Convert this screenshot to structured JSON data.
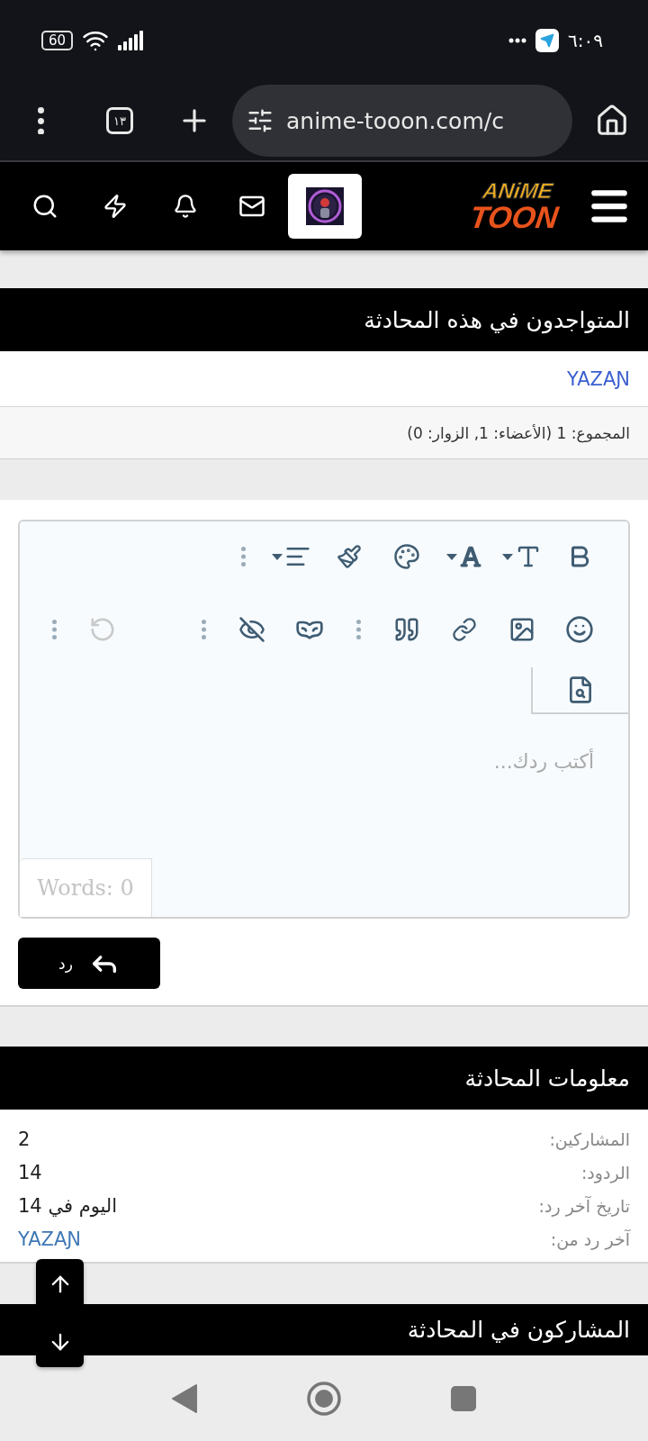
{
  "status_bar": {
    "time": "٦:٠٩",
    "battery": "60"
  },
  "browser": {
    "tab_count": "١٣",
    "url": "anime-tooon.com/c"
  },
  "site_header": {
    "logo": {
      "top": "ANiME",
      "bottom": "TOON"
    }
  },
  "online_section": {
    "title": "المتواجدون في هذه المحادثة",
    "members": [
      {
        "name": "YAZAƝ"
      }
    ],
    "total": "المجموع: 1 (الأعضاء: 1, الزوار: 0)"
  },
  "editor": {
    "placeholder": "أكتب ردك...",
    "word_count": "Words: 0",
    "undo_disabled": true,
    "reply_button": "رد"
  },
  "info_section": {
    "title": "معلومات المحادثة",
    "rows": [
      {
        "label": "المشاركين:",
        "value": "2",
        "kind": "text"
      },
      {
        "label": "الردود:",
        "value": "14",
        "kind": "text"
      },
      {
        "label": "تاريخ آخر رد:",
        "value": "اليوم في 14",
        "kind": "text"
      },
      {
        "label": "آخر رد من:",
        "value": "YAZAƝ",
        "kind": "link"
      }
    ]
  },
  "participants_section": {
    "title": "المشاركون في المحادثة"
  }
}
